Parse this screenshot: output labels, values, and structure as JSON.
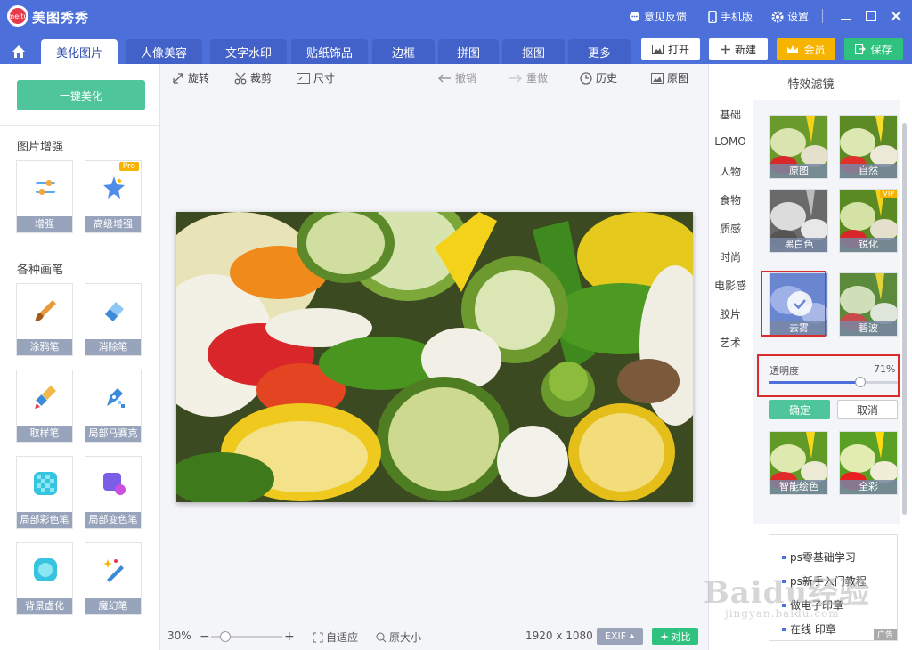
{
  "titlebar": {
    "logo_text": "meitu",
    "app_title": "美图秀秀",
    "feedback": "意见反馈",
    "mobile": "手机版",
    "settings": "设置"
  },
  "tabs": [
    {
      "label": "美化图片",
      "active": true
    },
    {
      "label": "人像美容"
    },
    {
      "label": "文字水印"
    },
    {
      "label": "贴纸饰品"
    },
    {
      "label": "边框"
    },
    {
      "label": "拼图"
    },
    {
      "label": "抠图"
    },
    {
      "label": "更多"
    }
  ],
  "top_actions": {
    "open": "打开",
    "new": "新建",
    "vip": "会员",
    "save": "保存"
  },
  "left": {
    "onekey": "一键美化",
    "section_enhance": "图片增强",
    "enhance_tools": [
      {
        "label": "增强"
      },
      {
        "label": "高级增强",
        "badge": "Pro"
      }
    ],
    "section_brushes": "各种画笔",
    "brushes": [
      {
        "label": "涂鸦笔"
      },
      {
        "label": "消除笔"
      },
      {
        "label": "取样笔"
      },
      {
        "label": "局部马赛克"
      },
      {
        "label": "局部彩色笔"
      },
      {
        "label": "局部变色笔"
      },
      {
        "label": "背景虚化"
      },
      {
        "label": "魔幻笔"
      }
    ]
  },
  "toolbar": {
    "rotate": "旋转",
    "crop": "裁剪",
    "size": "尺寸",
    "undo": "撤销",
    "redo": "重做",
    "history": "历史",
    "original": "原图"
  },
  "status": {
    "zoom": "30%",
    "zoom_level": 0.2,
    "fit": "自适应",
    "actual": "原大小",
    "dimensions": "1920 x 1080",
    "exif": "EXIF",
    "compare": "对比"
  },
  "right": {
    "title": "特效滤镜",
    "categories": [
      "基础",
      "LOMO",
      "人物",
      "食物",
      "质感",
      "时尚",
      "电影感",
      "胶片",
      "艺术"
    ],
    "filters": [
      {
        "label": "原图"
      },
      {
        "label": "自然"
      },
      {
        "label": "黑白色"
      },
      {
        "label": "锐化",
        "badge": "VIP"
      },
      {
        "label": "去雾",
        "selected": true
      },
      {
        "label": "碧波"
      },
      {
        "label": "智能绘色"
      },
      {
        "label": "全彩"
      }
    ],
    "opacity_label": "透明度",
    "opacity_value": "71%",
    "opacity_level": 0.71,
    "confirm": "确定",
    "cancel": "取消"
  },
  "ad": {
    "items": [
      "ps零基础学习",
      "ps新手入门教程",
      "做电子印章",
      "在线 印章"
    ],
    "tag": "广告"
  },
  "watermark": {
    "main": "Baidu经验",
    "sub": "jingyan.baidu.com"
  },
  "colors": {
    "brand": "#4d6fd9",
    "green": "#4ec59a",
    "vip": "#f6b400",
    "highlight": "#d92c2c"
  }
}
